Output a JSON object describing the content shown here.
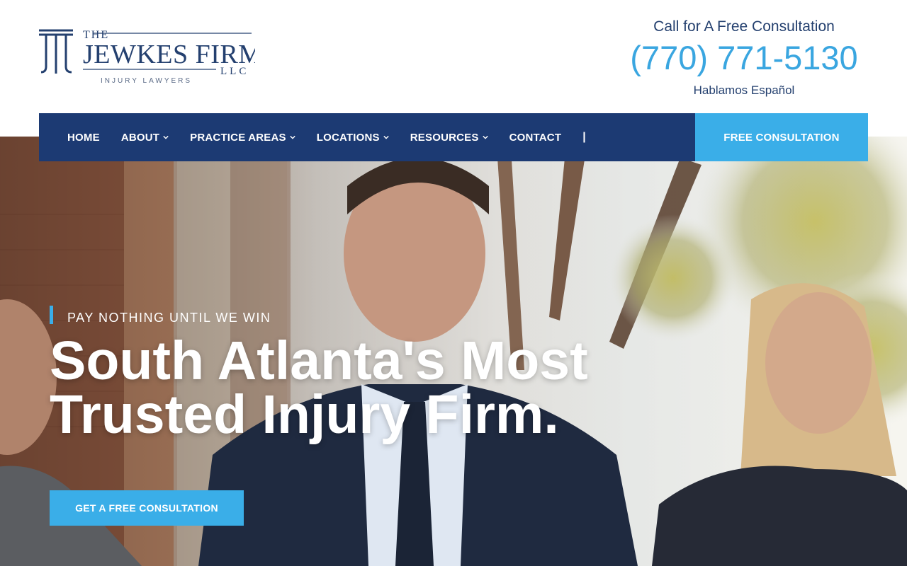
{
  "brand": {
    "top": "THE",
    "name": "JEWKES FIRM",
    "suffix": "LLC",
    "tagline": "INJURY LAWYERS"
  },
  "contact": {
    "call_text": "Call for A Free Consultation",
    "phone": "(770) 771-5130",
    "spanish": "Hablamos Español"
  },
  "nav": {
    "items": [
      {
        "label": "HOME",
        "dropdown": false
      },
      {
        "label": "ABOUT",
        "dropdown": true
      },
      {
        "label": "PRACTICE AREAS",
        "dropdown": true
      },
      {
        "label": "LOCATIONS",
        "dropdown": true
      },
      {
        "label": "RESOURCES",
        "dropdown": true
      },
      {
        "label": "CONTACT",
        "dropdown": false
      }
    ],
    "separator": "|",
    "cta": "FREE CONSULTATION"
  },
  "hero": {
    "eyebrow": "PAY NOTHING UNTIL WE WIN",
    "headline_line1": "South Atlanta's Most",
    "headline_line2": "Trusted Injury Firm.",
    "cta": "GET A FREE CONSULTATION"
  },
  "colors": {
    "navy": "#1c3a73",
    "accent_blue": "#3aaee8",
    "phone_blue": "#3aa6e0",
    "text_navy": "#24406f"
  }
}
